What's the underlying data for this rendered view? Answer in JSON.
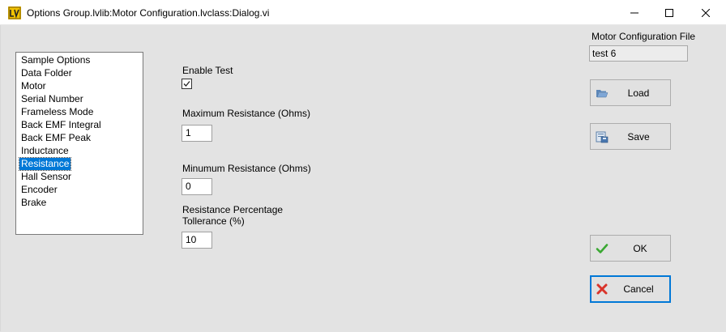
{
  "window": {
    "title": "Options Group.lvlib:Motor Configuration.lvclass:Dialog.vi"
  },
  "sidebar": {
    "items": [
      {
        "label": "Sample Options",
        "selected": false
      },
      {
        "label": "Data Folder",
        "selected": false
      },
      {
        "label": "Motor",
        "selected": false
      },
      {
        "label": "Serial Number",
        "selected": false
      },
      {
        "label": "Frameless Mode",
        "selected": false
      },
      {
        "label": "Back EMF Integral",
        "selected": false
      },
      {
        "label": "Back EMF Peak",
        "selected": false
      },
      {
        "label": "Inductance",
        "selected": false
      },
      {
        "label": "Resistance",
        "selected": true
      },
      {
        "label": "Hall Sensor",
        "selected": false
      },
      {
        "label": "Encoder",
        "selected": false
      },
      {
        "label": "Brake",
        "selected": false
      }
    ]
  },
  "form": {
    "enable_test_label": "Enable Test",
    "enable_test_checked": true,
    "max_res_label": "Maximum Resistance (Ohms)",
    "max_res_value": "1",
    "min_res_label": "Minumum Resistance (Ohms)",
    "min_res_value": "0",
    "tol_label_line1": "Resistance Percentage",
    "tol_label_line2": "Tollerance (%)",
    "tol_value": "10"
  },
  "config_file": {
    "label": "Motor Configuration File",
    "value": "test 6"
  },
  "buttons": {
    "load": "Load",
    "save": "Save",
    "ok": "OK",
    "cancel": "Cancel"
  },
  "colors": {
    "selection": "#0078d7",
    "ok_check": "#3aa832",
    "cancel_x": "#d9342b"
  }
}
